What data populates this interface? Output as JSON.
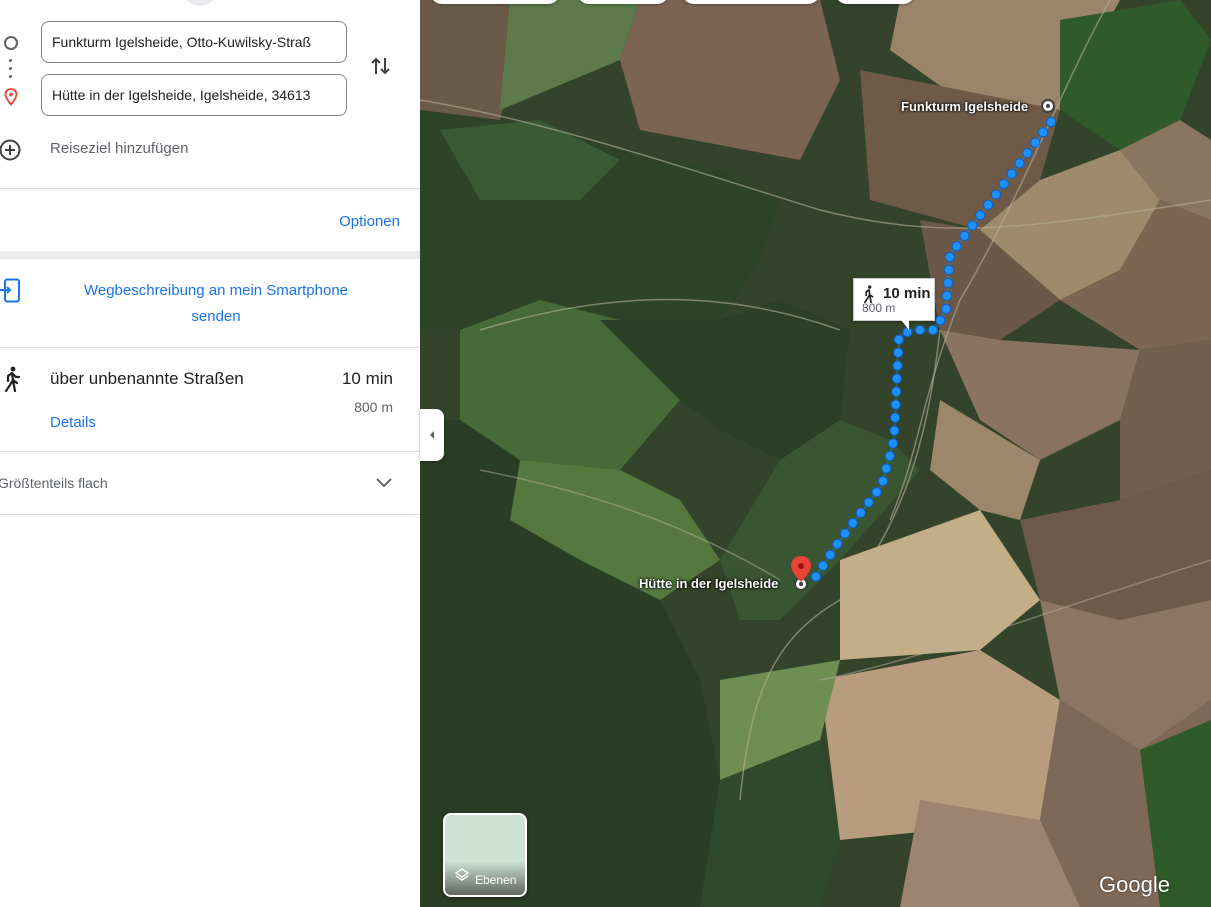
{
  "directions": {
    "origin": {
      "value": "Funkturm Igelsheide, Otto-Kuwilsky-Straß",
      "icon": "origin-circle-icon"
    },
    "destination": {
      "value": "Hütte in der Igelsheide, Igelsheide, 34613",
      "icon": "destination-pin-icon"
    },
    "swap_icon": "swap-vertical-icon",
    "add_destination": {
      "label": "Reiseziel hinzufügen",
      "icon": "add-circle-icon"
    },
    "options_label": "Optionen"
  },
  "send_to_phone": {
    "label": "Wegbeschreibung an mein Smartphone senden",
    "icon": "send-to-phone-icon"
  },
  "route": {
    "mode_icon": "walking-icon",
    "name": "über unbenannte Straßen",
    "time": "10 min",
    "distance": "800 m",
    "details_label": "Details"
  },
  "terrain": {
    "label": "Größtenteils flach",
    "icon": "chevron-down-icon"
  },
  "map": {
    "origin_label": "Funkturm Igelsheide",
    "destination_label": "Hütte in der Igelsheide",
    "bubble": {
      "time": "10 min",
      "distance": "800 m",
      "icon": "walking-icon"
    },
    "layers_label": "Ebenen",
    "logo": "Google",
    "route_color": "#1e90ff"
  },
  "colors": {
    "accent": "#1a73e8",
    "pin": "#ea4335"
  }
}
